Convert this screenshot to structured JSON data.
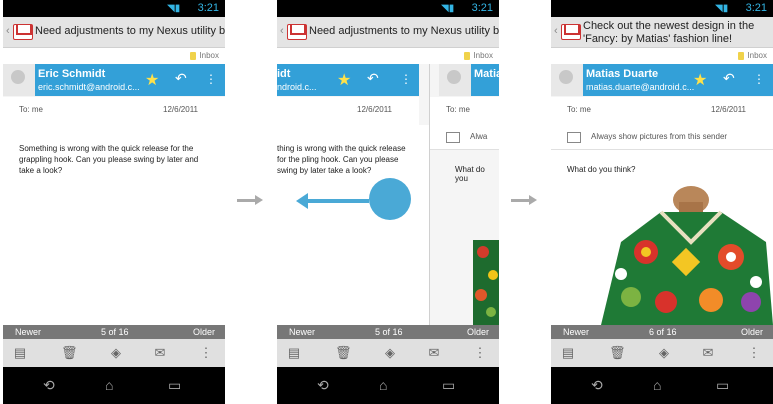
{
  "statusbar": {
    "time": "3:21"
  },
  "screen1": {
    "subject": "Need adjustments to my Nexus utility belt",
    "inbox_label": "Inbox",
    "sender_name": "Eric Schmidt",
    "sender_email": "eric.schmidt@android.c...",
    "to": "To: me",
    "date": "12/6/2011",
    "body": "Something is wrong with the quick release for the grappling hook. Can you please swing by later and take a look?",
    "newer": "Newer",
    "page": "5 of 16",
    "older": "Older"
  },
  "screen2": {
    "subject": "Need adjustments to my Nexus utility belt",
    "inbox_label": "Inbox",
    "sender_name_partial": "idt",
    "sender_email_partial": "ndroid.c...",
    "to": "To: me",
    "date": "12/6/2011",
    "body": "thing is wrong with the quick release for the pling hook. Can you please swing by later take a look?",
    "right_name_partial": "Matias",
    "right_to_partial": "To: me",
    "right_show_partial": "Alwa",
    "right_question_partial": "What do you",
    "newer": "Newer",
    "page": "5 of 16",
    "older": "Older"
  },
  "screen3": {
    "subject": "Check out the newest design in the 'Fancy: by Matias' fashion line!",
    "inbox_label": "Inbox",
    "sender_name": "Matias Duarte",
    "sender_email": "matias.duarte@android.c...",
    "to": "To: me",
    "date": "12/6/2011",
    "show_pictures": "Always show pictures from this sender",
    "question": "What do you think?",
    "newer": "Newer",
    "page": "6 of 16",
    "older": "Older"
  },
  "icons": [
    "wifi-icon",
    "signal-icon",
    "battery-icon",
    "gmail-icon",
    "star-icon",
    "reply-icon",
    "overflow-menu-icon",
    "archive-icon",
    "delete-icon",
    "label-icon",
    "mark-unread-icon",
    "back-icon",
    "home-icon",
    "recents-icon",
    "picture-icon",
    "arrow-right-icon",
    "swipe-left-icon"
  ],
  "colors": {
    "accent": "#33a0d8",
    "star": "#ffe24a",
    "swipe": "#4aa9d6"
  }
}
